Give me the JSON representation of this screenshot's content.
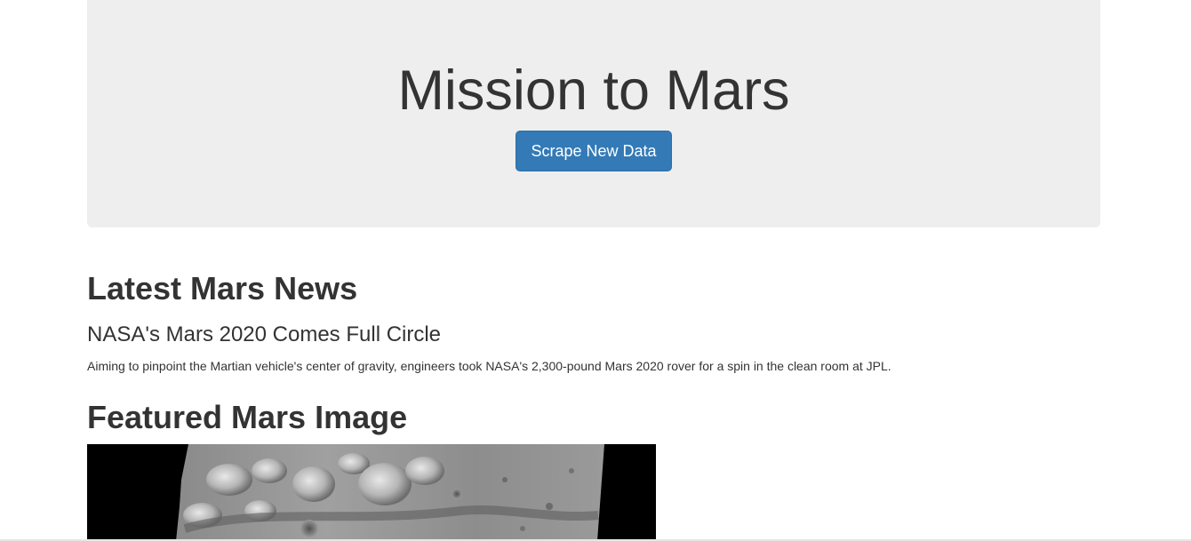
{
  "header": {
    "title": "Mission to Mars",
    "scrape_button_label": "Scrape New Data"
  },
  "news": {
    "section_title": "Latest Mars News",
    "headline": "NASA's Mars 2020 Comes Full Circle",
    "teaser": "Aiming to pinpoint the Martian vehicle's center of gravity, engineers took NASA's 2,300-pound Mars 2020 rover for a spin in the clean room at JPL."
  },
  "featured_image": {
    "section_title": "Featured Mars Image"
  },
  "colors": {
    "jumbotron_bg": "#eeeeee",
    "button_primary": "#337ab7",
    "text": "#333333"
  }
}
